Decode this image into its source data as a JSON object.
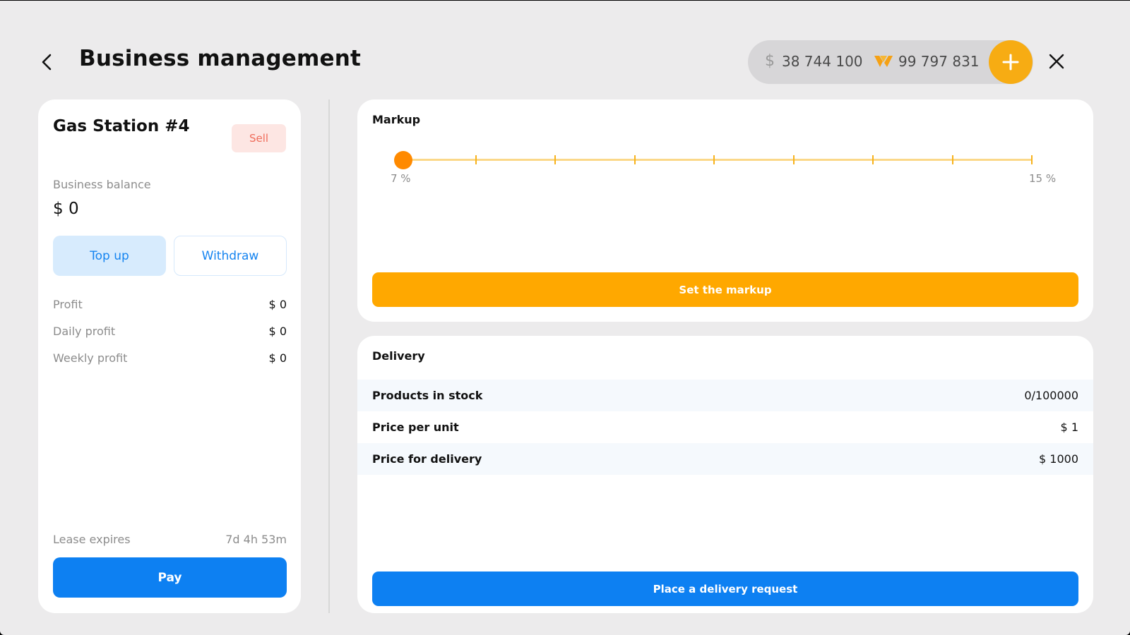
{
  "header": {
    "title": "Business management",
    "back_icon": "chevron-left-icon",
    "close_icon": "close-icon"
  },
  "wallet": {
    "cash_symbol": "$",
    "cash": "38 744 100",
    "coins": "99 797 831",
    "add_icon": "plus-icon"
  },
  "business": {
    "name": "Gas Station #4",
    "sell_label": "Sell",
    "balance_label": "Business balance",
    "balance_value": "$ 0",
    "topup_label": "Top up",
    "withdraw_label": "Withdraw",
    "stats": [
      {
        "label": "Profit",
        "value": "$ 0"
      },
      {
        "label": "Daily profit",
        "value": "$ 0"
      },
      {
        "label": "Weekly profit",
        "value": "$ 0"
      }
    ],
    "lease_label": "Lease expires",
    "lease_value": "7d 4h 53m",
    "pay_label": "Pay"
  },
  "markup": {
    "title": "Markup",
    "min_label": "7 %",
    "max_label": "15 %",
    "min": 7,
    "max": 15,
    "value": 7,
    "steps": 9,
    "set_label": "Set the markup"
  },
  "delivery": {
    "title": "Delivery",
    "rows": [
      {
        "label": "Products in stock",
        "value": "0/100000"
      },
      {
        "label": "Price per unit",
        "value": "$ 1"
      },
      {
        "label": "Price for delivery",
        "value": "$ 1000"
      }
    ],
    "request_label": "Place a delivery request"
  },
  "colors": {
    "accent_orange": "#ffa800",
    "slider_thumb": "#ff8a00",
    "primary_blue": "#0d80f2",
    "sell_red": "#ef6d5b"
  }
}
